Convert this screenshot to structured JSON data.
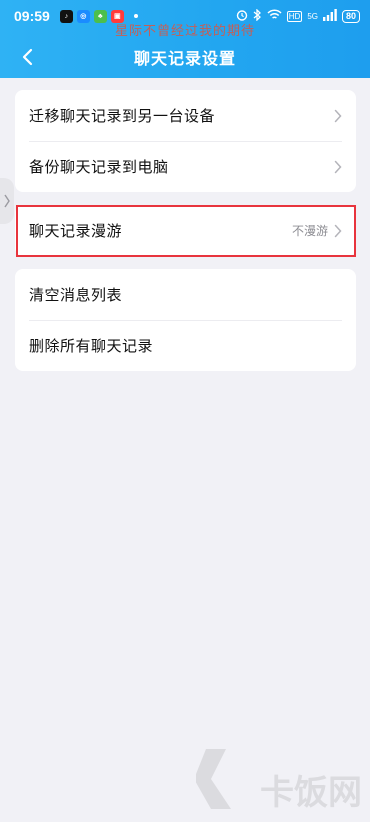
{
  "status_bar": {
    "time": "09:59",
    "network": "5G",
    "battery": "80",
    "app_icons": [
      "tiktok-icon",
      "browser-icon",
      "sprout-icon",
      "shop-icon"
    ]
  },
  "overlay": {
    "text": "星际不曾经过我的期待"
  },
  "header": {
    "title": "聊天记录设置"
  },
  "groups": [
    {
      "items": [
        {
          "label": "迁移聊天记录到另一台设备"
        },
        {
          "label": "备份聊天记录到电脑"
        }
      ]
    },
    {
      "items": [
        {
          "label": "聊天记录漫游",
          "value": "不漫游"
        }
      ]
    },
    {
      "items": [
        {
          "label": "清空消息列表"
        },
        {
          "label": "删除所有聊天记录"
        }
      ]
    }
  ],
  "watermark": {
    "text": "卡饭网"
  },
  "colors": {
    "header_start": "#2fb2f4",
    "header_end": "#1e9eee",
    "background": "#f1f1f6",
    "highlight": "#e8343d"
  }
}
